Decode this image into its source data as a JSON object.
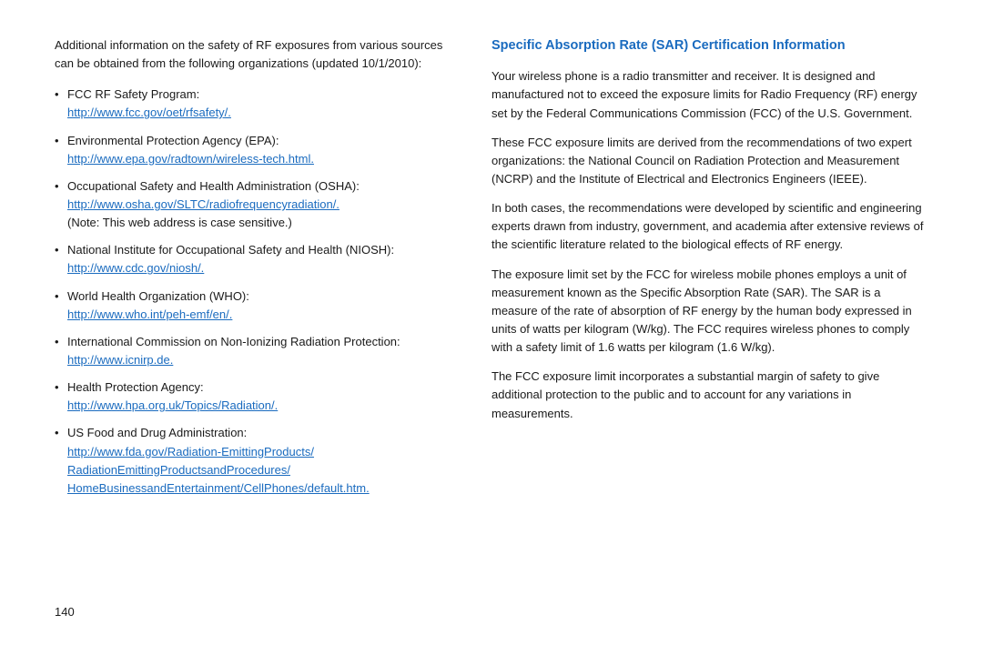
{
  "left": {
    "intro": "Additional information on the safety of RF exposures from various sources can be obtained from the following organizations (updated 10/1/2010):",
    "bullets": [
      {
        "label": "FCC RF Safety Program:",
        "link": "http://www.fcc.gov/oet/rfsafety/.",
        "note": null
      },
      {
        "label": "Environmental Protection Agency (EPA):",
        "link": "http://www.epa.gov/radtown/wireless-tech.html.",
        "note": null
      },
      {
        "label": "Occupational Safety and Health Administration (OSHA):",
        "link": "http://www.osha.gov/SLTC/radiofrequencyradiation/.",
        "note": "(Note: This web address is case sensitive.)"
      },
      {
        "label": "National Institute for Occupational Safety and Health (NIOSH):",
        "link": "http://www.cdc.gov/niosh/.",
        "note": null
      },
      {
        "label": "World Health Organization (WHO):",
        "link": "http://www.who.int/peh-emf/en/.",
        "note": null
      },
      {
        "label": "International Commission on Non-Ionizing Radiation Protection:",
        "link": "http://www.icnirp.de.",
        "note": null
      },
      {
        "label": "Health Protection Agency:",
        "link": "http://www.hpa.org.uk/Topics/Radiation/.",
        "note": null
      },
      {
        "label": "US Food and Drug Administration:",
        "link_lines": [
          "http://www.fda.gov/Radiation-EmittingProducts/",
          "RadiationEmittingProductsandProcedures/",
          "HomeBusinessandEntertainment/CellPhones/default.htm."
        ],
        "note": null
      }
    ]
  },
  "right": {
    "section_title": "Specific Absorption Rate (SAR) Certification Information",
    "paragraphs": [
      "Your wireless phone is a radio transmitter and receiver. It is designed and manufactured not to exceed the exposure limits for Radio Frequency (RF) energy set by the Federal Communications Commission (FCC) of the U.S. Government.",
      "These FCC exposure limits are derived from the recommendations of two expert organizations: the National Council on Radiation Protection and Measurement (NCRP) and the Institute of Electrical and Electronics Engineers (IEEE).",
      "In both cases, the recommendations were developed by scientific and engineering experts drawn from industry, government, and academia after extensive reviews of the scientific literature related to the biological effects of RF energy.",
      "The exposure limit set by the FCC for wireless mobile phones employs a unit of measurement known as the Specific Absorption Rate (SAR). The SAR is a measure of the rate of absorption of RF energy by the human body expressed in units of watts per kilogram (W/kg). The FCC requires wireless phones to comply with a safety limit of 1.6 watts per kilogram (1.6 W/kg).",
      "The FCC exposure limit incorporates a substantial margin of safety to give additional protection to the public and to account for any variations in measurements."
    ]
  },
  "footer": {
    "page_number": "140"
  }
}
